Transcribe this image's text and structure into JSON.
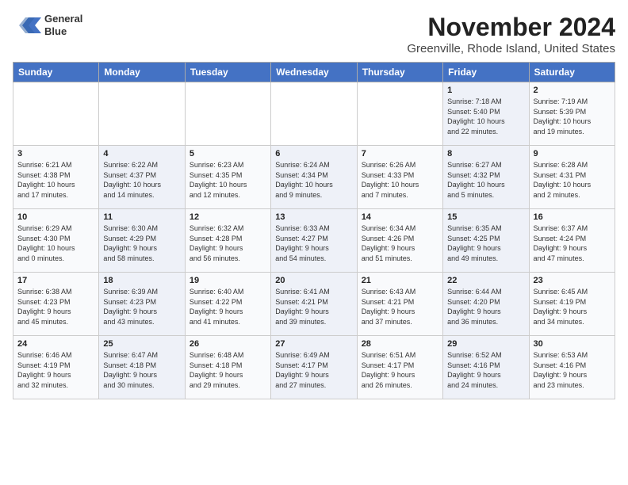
{
  "header": {
    "logo_line1": "General",
    "logo_line2": "Blue",
    "title": "November 2024",
    "location": "Greenville, Rhode Island, United States"
  },
  "days_of_week": [
    "Sunday",
    "Monday",
    "Tuesday",
    "Wednesday",
    "Thursday",
    "Friday",
    "Saturday"
  ],
  "weeks": [
    [
      {
        "num": "",
        "info": ""
      },
      {
        "num": "",
        "info": ""
      },
      {
        "num": "",
        "info": ""
      },
      {
        "num": "",
        "info": ""
      },
      {
        "num": "",
        "info": ""
      },
      {
        "num": "1",
        "info": "Sunrise: 7:18 AM\nSunset: 5:40 PM\nDaylight: 10 hours\nand 22 minutes."
      },
      {
        "num": "2",
        "info": "Sunrise: 7:19 AM\nSunset: 5:39 PM\nDaylight: 10 hours\nand 19 minutes."
      }
    ],
    [
      {
        "num": "3",
        "info": "Sunrise: 6:21 AM\nSunset: 4:38 PM\nDaylight: 10 hours\nand 17 minutes."
      },
      {
        "num": "4",
        "info": "Sunrise: 6:22 AM\nSunset: 4:37 PM\nDaylight: 10 hours\nand 14 minutes."
      },
      {
        "num": "5",
        "info": "Sunrise: 6:23 AM\nSunset: 4:35 PM\nDaylight: 10 hours\nand 12 minutes."
      },
      {
        "num": "6",
        "info": "Sunrise: 6:24 AM\nSunset: 4:34 PM\nDaylight: 10 hours\nand 9 minutes."
      },
      {
        "num": "7",
        "info": "Sunrise: 6:26 AM\nSunset: 4:33 PM\nDaylight: 10 hours\nand 7 minutes."
      },
      {
        "num": "8",
        "info": "Sunrise: 6:27 AM\nSunset: 4:32 PM\nDaylight: 10 hours\nand 5 minutes."
      },
      {
        "num": "9",
        "info": "Sunrise: 6:28 AM\nSunset: 4:31 PM\nDaylight: 10 hours\nand 2 minutes."
      }
    ],
    [
      {
        "num": "10",
        "info": "Sunrise: 6:29 AM\nSunset: 4:30 PM\nDaylight: 10 hours\nand 0 minutes."
      },
      {
        "num": "11",
        "info": "Sunrise: 6:30 AM\nSunset: 4:29 PM\nDaylight: 9 hours\nand 58 minutes."
      },
      {
        "num": "12",
        "info": "Sunrise: 6:32 AM\nSunset: 4:28 PM\nDaylight: 9 hours\nand 56 minutes."
      },
      {
        "num": "13",
        "info": "Sunrise: 6:33 AM\nSunset: 4:27 PM\nDaylight: 9 hours\nand 54 minutes."
      },
      {
        "num": "14",
        "info": "Sunrise: 6:34 AM\nSunset: 4:26 PM\nDaylight: 9 hours\nand 51 minutes."
      },
      {
        "num": "15",
        "info": "Sunrise: 6:35 AM\nSunset: 4:25 PM\nDaylight: 9 hours\nand 49 minutes."
      },
      {
        "num": "16",
        "info": "Sunrise: 6:37 AM\nSunset: 4:24 PM\nDaylight: 9 hours\nand 47 minutes."
      }
    ],
    [
      {
        "num": "17",
        "info": "Sunrise: 6:38 AM\nSunset: 4:23 PM\nDaylight: 9 hours\nand 45 minutes."
      },
      {
        "num": "18",
        "info": "Sunrise: 6:39 AM\nSunset: 4:23 PM\nDaylight: 9 hours\nand 43 minutes."
      },
      {
        "num": "19",
        "info": "Sunrise: 6:40 AM\nSunset: 4:22 PM\nDaylight: 9 hours\nand 41 minutes."
      },
      {
        "num": "20",
        "info": "Sunrise: 6:41 AM\nSunset: 4:21 PM\nDaylight: 9 hours\nand 39 minutes."
      },
      {
        "num": "21",
        "info": "Sunrise: 6:43 AM\nSunset: 4:21 PM\nDaylight: 9 hours\nand 37 minutes."
      },
      {
        "num": "22",
        "info": "Sunrise: 6:44 AM\nSunset: 4:20 PM\nDaylight: 9 hours\nand 36 minutes."
      },
      {
        "num": "23",
        "info": "Sunrise: 6:45 AM\nSunset: 4:19 PM\nDaylight: 9 hours\nand 34 minutes."
      }
    ],
    [
      {
        "num": "24",
        "info": "Sunrise: 6:46 AM\nSunset: 4:19 PM\nDaylight: 9 hours\nand 32 minutes."
      },
      {
        "num": "25",
        "info": "Sunrise: 6:47 AM\nSunset: 4:18 PM\nDaylight: 9 hours\nand 30 minutes."
      },
      {
        "num": "26",
        "info": "Sunrise: 6:48 AM\nSunset: 4:18 PM\nDaylight: 9 hours\nand 29 minutes."
      },
      {
        "num": "27",
        "info": "Sunrise: 6:49 AM\nSunset: 4:17 PM\nDaylight: 9 hours\nand 27 minutes."
      },
      {
        "num": "28",
        "info": "Sunrise: 6:51 AM\nSunset: 4:17 PM\nDaylight: 9 hours\nand 26 minutes."
      },
      {
        "num": "29",
        "info": "Sunrise: 6:52 AM\nSunset: 4:16 PM\nDaylight: 9 hours\nand 24 minutes."
      },
      {
        "num": "30",
        "info": "Sunrise: 6:53 AM\nSunset: 4:16 PM\nDaylight: 9 hours\nand 23 minutes."
      }
    ]
  ]
}
